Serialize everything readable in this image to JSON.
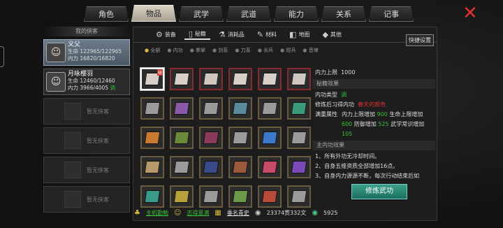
{
  "top_tabs": [
    "角色",
    "物品",
    "武学",
    "武道",
    "能力",
    "关系",
    "记事"
  ],
  "left": {
    "title": "我的侠客",
    "heroes": [
      {
        "name": "义父",
        "hp_label": "生命",
        "hp": "122965/122965",
        "mp_label": "内力",
        "mp": "16820/16820"
      },
      {
        "name": "月咏樱羽",
        "hp_label": "生命",
        "hp": "12460/12460",
        "mp_label": "内力",
        "mp": "3966/4005",
        "tag": "调"
      }
    ],
    "empty_label": "暂无侠客"
  },
  "subtabs": [
    {
      "icon": "⚙",
      "label": "装备"
    },
    {
      "icon": "▯",
      "label": "秘籍"
    },
    {
      "icon": "⚗",
      "label": "消耗品"
    },
    {
      "icon": "✎",
      "label": "材料"
    },
    {
      "icon": "◧",
      "label": "地图"
    },
    {
      "icon": "◆",
      "label": "其他"
    }
  ],
  "quick_settings": "快捷设置",
  "filters": [
    "全部",
    "内功",
    "拳掌",
    "剑系",
    "刀系",
    "长兵",
    "短兵",
    "音律"
  ],
  "items": [
    {
      "color": "#d8d0c8",
      "border": "sel",
      "badge": "秘"
    },
    {
      "color": "#d8d0c8",
      "border": "red"
    },
    {
      "color": "#d0c8c0",
      "border": "red"
    },
    {
      "color": "#d8d0c8",
      "border": "red"
    },
    {
      "color": "#d8d0c8",
      "border": "red"
    },
    {
      "color": "#d0c8c0",
      "border": "red"
    },
    {
      "color": "#9a9a9a",
      "border": "n"
    },
    {
      "color": "#8a5aa8",
      "border": "n"
    },
    {
      "color": "#9a9a9a",
      "border": "n"
    },
    {
      "color": "#5a8a9a",
      "border": "n"
    },
    {
      "color": "#9a9a9a",
      "border": "n"
    },
    {
      "color": "#3a9a7a",
      "border": "n"
    },
    {
      "color": "#c87a30",
      "border": "n"
    },
    {
      "color": "#6a8a3a",
      "border": "n"
    },
    {
      "color": "#8a3a5a",
      "border": "n"
    },
    {
      "color": "#9a9a9a",
      "border": "n"
    },
    {
      "color": "#3a7ac8",
      "border": "n"
    },
    {
      "color": "#9a9a9a",
      "border": "n"
    },
    {
      "color": "#b89a6a",
      "border": "n"
    },
    {
      "color": "#9a9a9a",
      "border": "n"
    },
    {
      "color": "#3a4a8a",
      "border": "n"
    },
    {
      "color": "#9a5a3a",
      "border": "n"
    },
    {
      "color": "#c84a6a",
      "border": "n"
    },
    {
      "color": "#7a4ab8",
      "border": "n"
    },
    {
      "color": "#3a9a8a",
      "border": "n"
    },
    {
      "color": "#b8a03a",
      "border": "n"
    },
    {
      "color": "#9a9a9a",
      "border": "n"
    },
    {
      "color": "#6a9a4a",
      "border": "n"
    },
    {
      "color": "#b84a3a",
      "border": "n"
    },
    {
      "color": "#9a9a9a",
      "border": "n"
    }
  ],
  "detail": {
    "limit_label": "内力上限",
    "limit_value": "1000",
    "sec1": "秘籍效果",
    "type_label": "内功类型",
    "type_value": "调",
    "learn_label": "修炼后习得内功",
    "learn_value": "春天的颜色",
    "attr_label": "满重属性",
    "attr_p1": "内力上限增加",
    "attr_v1": "900",
    "attr_p2": "生命上限增加",
    "attr_v2": "600",
    "attr_p3": "防御增加",
    "attr_v3": "525",
    "attr_p4": "武学常识增加",
    "attr_v4": "105",
    "sec2": "主内功效果",
    "effects": [
      "1、所有外功无冷却时间。",
      "2、自身五维资质全部增加16点。",
      "3、自身内力源源不断，每次行动结束后如"
    ],
    "button": "修炼武功"
  },
  "bottom": {
    "item1": "主机勤勉",
    "item2": "志得意满",
    "item3": "垂名青史",
    "money": "23374贯332文",
    "jade": "5925"
  }
}
